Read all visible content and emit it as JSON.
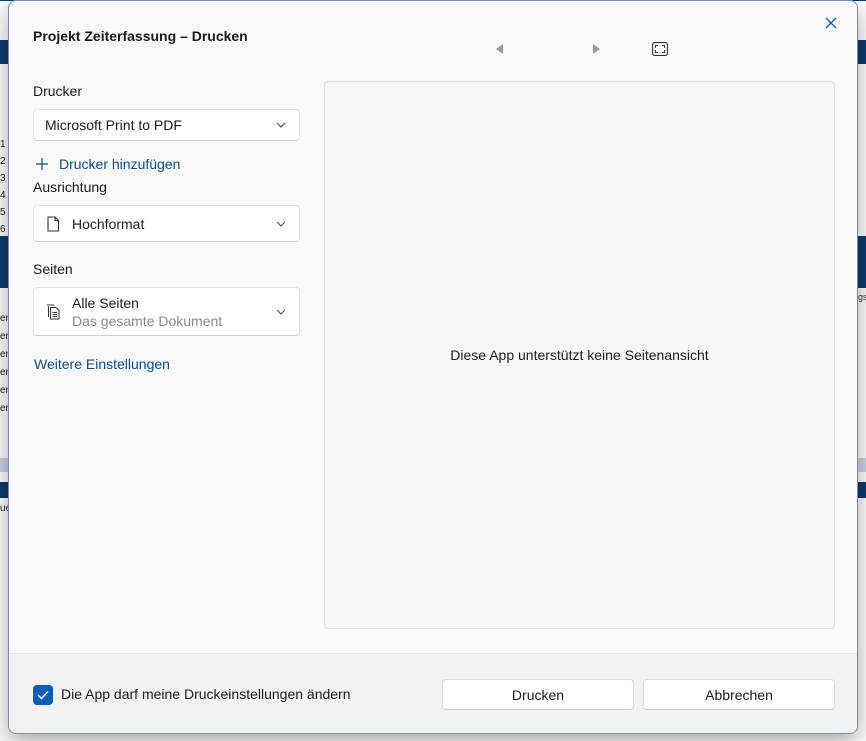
{
  "background": {
    "left_numbers": [
      "1",
      "2",
      "3",
      "4",
      "5",
      "6"
    ],
    "left_texts": [
      "er",
      "er",
      "er",
      "er",
      "er",
      "er"
    ],
    "left_bottom": "ue",
    "right_text": "gs"
  },
  "dialog": {
    "title": "Projekt Zeiterfassung – Drucken",
    "printer": {
      "label": "Drucker",
      "value": "Microsoft Print to PDF",
      "add_link": "Drucker hinzufügen"
    },
    "orientation": {
      "label": "Ausrichtung",
      "value": "Hochformat"
    },
    "pages": {
      "label": "Seiten",
      "value": "Alle Seiten",
      "sub": "Das gesamte Dokument"
    },
    "more_settings": "Weitere Einstellungen",
    "preview_message": "Diese App unterstützt keine Seitenansicht",
    "footer": {
      "checkbox_label": "Die App darf meine Druckeinstellungen ändern",
      "checkbox_checked": true,
      "print_button": "Drucken",
      "cancel_button": "Abbrechen"
    }
  },
  "colors": {
    "accent": "#0a5fb4",
    "link": "#0a4d8c",
    "background_band": "#0c3b6e"
  }
}
